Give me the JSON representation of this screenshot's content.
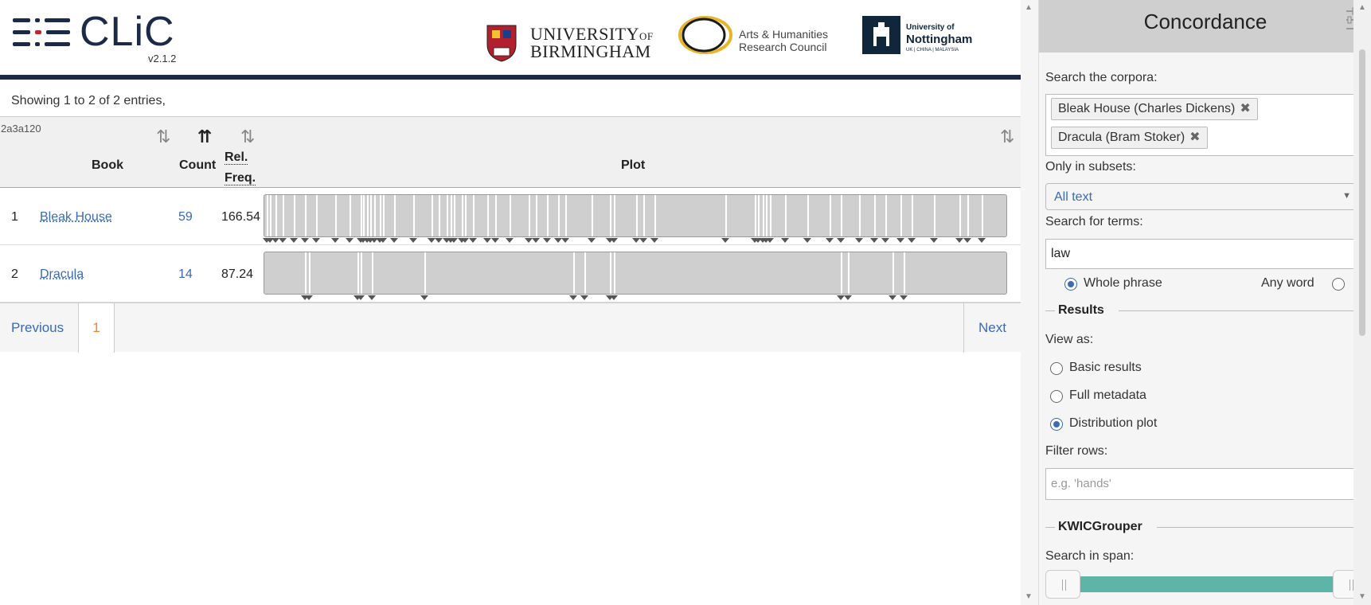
{
  "header": {
    "app_name": "CLiC",
    "version": "v2.1.2",
    "partners": {
      "birmingham": [
        "UNIVERSITY",
        "OF",
        "BIRMINGHAM"
      ],
      "ahrc": [
        "Arts & Humanities",
        "Research Council"
      ],
      "nottingham": [
        "University of",
        "Nottingham",
        "UK | CHINA | MALAYSIA"
      ]
    }
  },
  "results": {
    "info": "Showing 1 to 2 of 2 entries,",
    "table_id": "2a3a120",
    "columns": {
      "book": "Book",
      "count": "Count",
      "rel_freq_line1": "Rel.",
      "rel_freq_line2": "Freq.",
      "plot": "Plot"
    },
    "rows": [
      {
        "num": "1",
        "book": "Bleak House",
        "count": "59",
        "rel_freq": "166.54",
        "hits": [
          0.003,
          0.008,
          0.015,
          0.025,
          0.04,
          0.055,
          0.07,
          0.095,
          0.115,
          0.13,
          0.133,
          0.138,
          0.142,
          0.148,
          0.155,
          0.16,
          0.175,
          0.2,
          0.225,
          0.235,
          0.245,
          0.25,
          0.255,
          0.265,
          0.27,
          0.28,
          0.3,
          0.31,
          0.33,
          0.355,
          0.365,
          0.38,
          0.395,
          0.405,
          0.44,
          0.465,
          0.47,
          0.5,
          0.51,
          0.525,
          0.62,
          0.66,
          0.664,
          0.67,
          0.675,
          0.68,
          0.7,
          0.73,
          0.76,
          0.775,
          0.8,
          0.82,
          0.835,
          0.855,
          0.87,
          0.9,
          0.935,
          0.945,
          0.965
        ]
      },
      {
        "num": "2",
        "book": "Dracula",
        "count": "14",
        "rel_freq": "87.24",
        "hits": [
          0.055,
          0.06,
          0.125,
          0.13,
          0.145,
          0.215,
          0.415,
          0.43,
          0.465,
          0.47,
          0.775,
          0.785,
          0.845,
          0.86
        ]
      }
    ]
  },
  "pagination": {
    "previous": "Previous",
    "current": "1",
    "next": "Next"
  },
  "sidebar": {
    "title": "Concordance",
    "corpora_label": "Search the corpora:",
    "corpora": [
      "Bleak House (Charles Dickens)",
      "Dracula (Bram Stoker)"
    ],
    "remove_glyph": "✖",
    "subsets_label": "Only in subsets:",
    "subset_value": "All text",
    "terms_label": "Search for terms:",
    "terms_value": "law",
    "whole_phrase": "Whole phrase",
    "any_word": "Any word",
    "results_section": "Results",
    "view_as_label": "View as:",
    "view_options": [
      "Basic results",
      "Full metadata",
      "Distribution plot"
    ],
    "selected_view": "Distribution plot",
    "filter_label": "Filter rows:",
    "filter_placeholder": "e.g. 'hands'",
    "kwic_section": "KWICGrouper",
    "span_label": "Search in span:"
  },
  "colors": {
    "navy": "#1c2a4a",
    "link": "#3a6ab8",
    "accent_orange": "#e8833a",
    "slider_fill": "#5eb5a7"
  }
}
